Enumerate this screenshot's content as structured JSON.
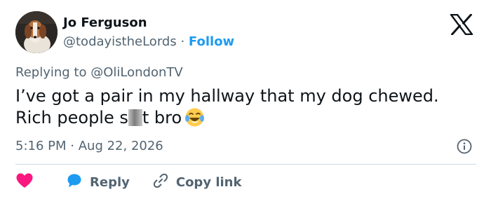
{
  "author": {
    "name": "Jo Ferguson",
    "handle": "@todayistheLords",
    "separator": "·",
    "follow_label": "Follow"
  },
  "reply_context": {
    "prefix": "Replying to",
    "mention": "@OliLondonTV"
  },
  "tweet": {
    "line1": "I’ve got a pair in my hallway that my dog chewed.",
    "line2_before": "Rich people s",
    "line2_after": "t bro",
    "emoji": "face-with-tears-of-joy"
  },
  "timestamp": {
    "time": "5:16 PM",
    "separator": "·",
    "date": "Aug 22, 2026"
  },
  "actions": {
    "like_label": "",
    "reply_label": "Reply",
    "copy_link_label": "Copy link"
  },
  "colors": {
    "text": "#0f1419",
    "muted": "#536471",
    "accent": "#1d9bf0",
    "like": "#f91880",
    "divider": "#cfd9de"
  },
  "icons": {
    "brand": "x-logo-icon",
    "info": "info-icon",
    "like": "heart-icon",
    "reply": "speech-bubble-icon",
    "copy_link": "link-icon"
  }
}
